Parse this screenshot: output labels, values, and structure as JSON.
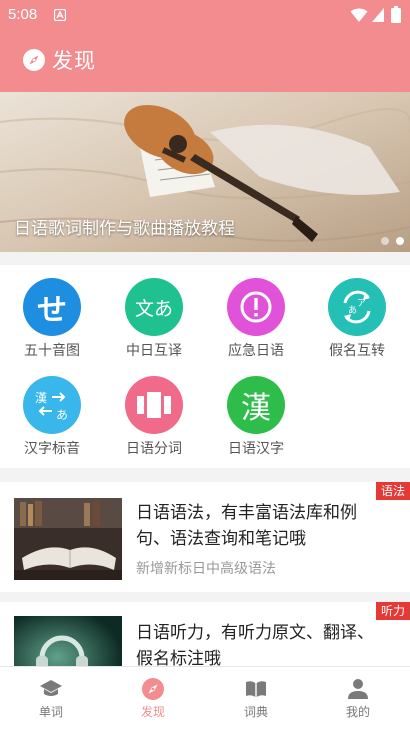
{
  "status_bar": {
    "time": "5:08"
  },
  "header": {
    "title": "发现"
  },
  "banner": {
    "caption": "日语歌词制作与歌曲播放教程",
    "slide_count": 2,
    "active_slide": 2
  },
  "features": [
    {
      "label": "五十音图",
      "color": "#1e8fe0",
      "icon": "se-kana-icon",
      "glyph": "せ"
    },
    {
      "label": "中日互译",
      "color": "#1fc28f",
      "icon": "translate-icon",
      "glyph": "文あ"
    },
    {
      "label": "应急日语",
      "color": "#e052d8",
      "icon": "alert-icon",
      "glyph": "!"
    },
    {
      "label": "假名互转",
      "color": "#25c0b5",
      "icon": "convert-icon",
      "glyph": "あア"
    },
    {
      "label": "汉字标音",
      "color": "#39b7ea",
      "icon": "kanji-ruby-icon",
      "glyph": "漢あ"
    },
    {
      "label": "日语分词",
      "color": "#f06b8a",
      "icon": "segment-icon",
      "glyph": ""
    },
    {
      "label": "日语汉字",
      "color": "#2ebd4a",
      "icon": "kanji-icon",
      "glyph": "漢"
    }
  ],
  "articles": [
    {
      "headline": "日语语法，有丰富语法库和例句、语法查询和笔记哦",
      "sub": "新增新标日中高级语法",
      "tag": "语法",
      "tag_color": "#e53935"
    },
    {
      "headline": "日语听力，有听力原文、翻译、假名标注哦",
      "sub": "",
      "tag": "听力",
      "tag_color": "#e53935"
    }
  ],
  "nav": {
    "items": [
      {
        "label": "单词",
        "icon": "graduation-cap-icon"
      },
      {
        "label": "发现",
        "icon": "compass-icon"
      },
      {
        "label": "词典",
        "icon": "book-icon"
      },
      {
        "label": "我的",
        "icon": "person-icon"
      }
    ],
    "active": "发现",
    "active_color": "#f28c8e"
  },
  "colors": {
    "header": "#f28c8e",
    "accent": "#f28c8e"
  }
}
